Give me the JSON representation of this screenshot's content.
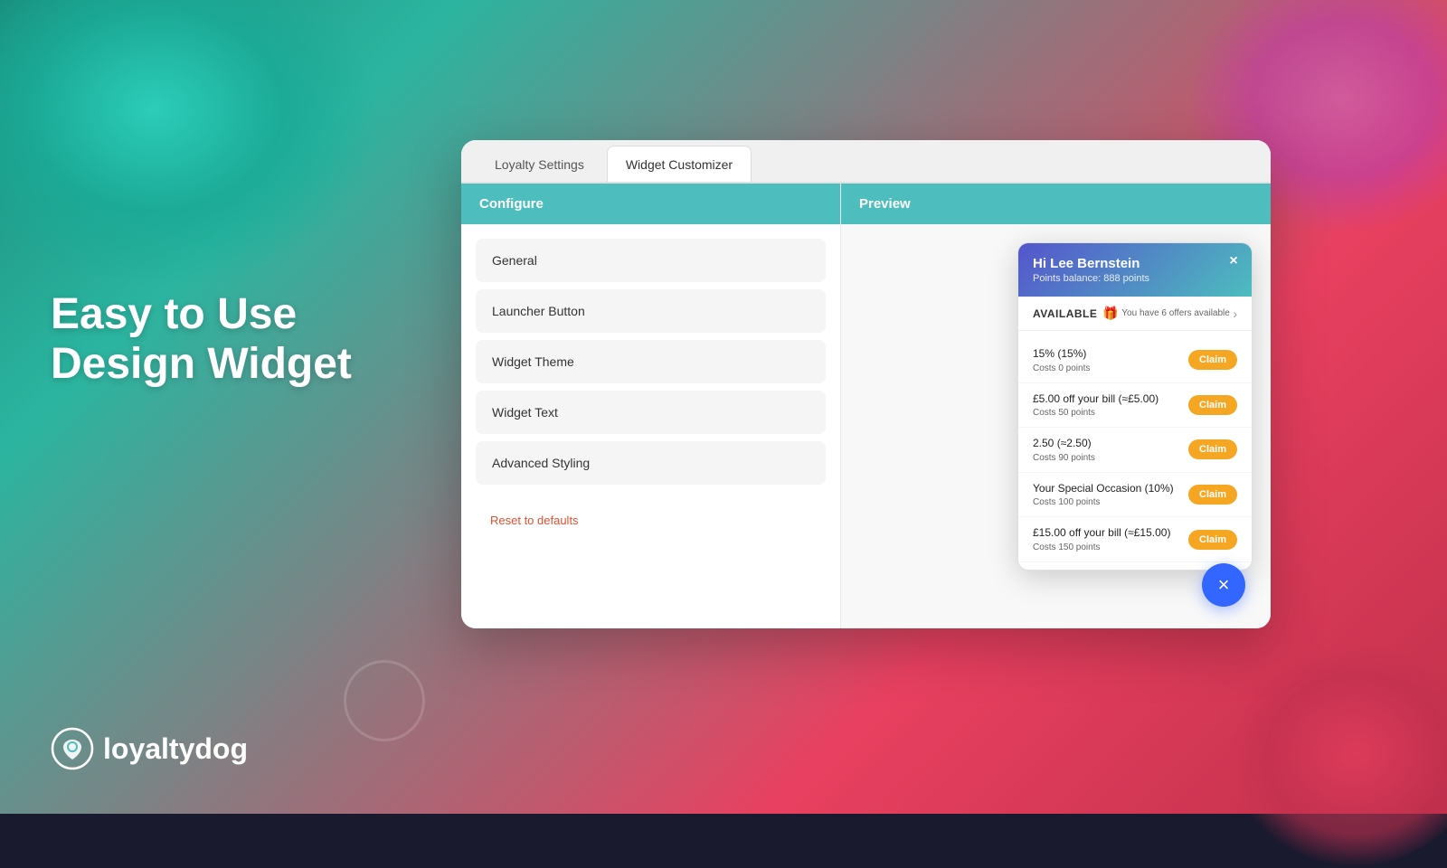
{
  "background": {
    "colors": [
      "#1a8a7a",
      "#2bb5a0",
      "#e84060",
      "#c0304a"
    ]
  },
  "hero": {
    "line1": "Easy to Use",
    "line2": "Design Widget"
  },
  "logo": {
    "text": "loyaltydog"
  },
  "tabs": [
    {
      "label": "Loyalty Settings",
      "active": false
    },
    {
      "label": "Widget Customizer",
      "active": true
    }
  ],
  "configure": {
    "header": "Configure",
    "menu": [
      {
        "label": "General"
      },
      {
        "label": "Launcher Button"
      },
      {
        "label": "Widget Theme"
      },
      {
        "label": "Widget Text"
      },
      {
        "label": "Advanced Styling"
      }
    ],
    "reset_label": "Reset to defaults"
  },
  "preview": {
    "header": "Preview",
    "widget": {
      "greeting": "Hi Lee Bernstein",
      "points_balance": "Points balance: 888 points",
      "available_label": "AVAILABLE",
      "available_sub": "You have 6 offers available",
      "offers": [
        {
          "title": "15% (15%)",
          "cost": "Costs 0 points",
          "claim": "Claim"
        },
        {
          "title": "£5.00 off your bill (≈£5.00)",
          "cost": "Costs 50 points",
          "claim": "Claim"
        },
        {
          "title": "2.50 (≈2.50)",
          "cost": "Costs 90 points",
          "claim": "Claim"
        },
        {
          "title": "Your Special Occasion (10%)",
          "cost": "Costs 100 points",
          "claim": "Claim"
        },
        {
          "title": "£15.00 off your bill (≈£15.00)",
          "cost": "Costs 150 points",
          "claim": "Claim"
        }
      ],
      "close_label": "×",
      "fab_label": "×"
    }
  }
}
